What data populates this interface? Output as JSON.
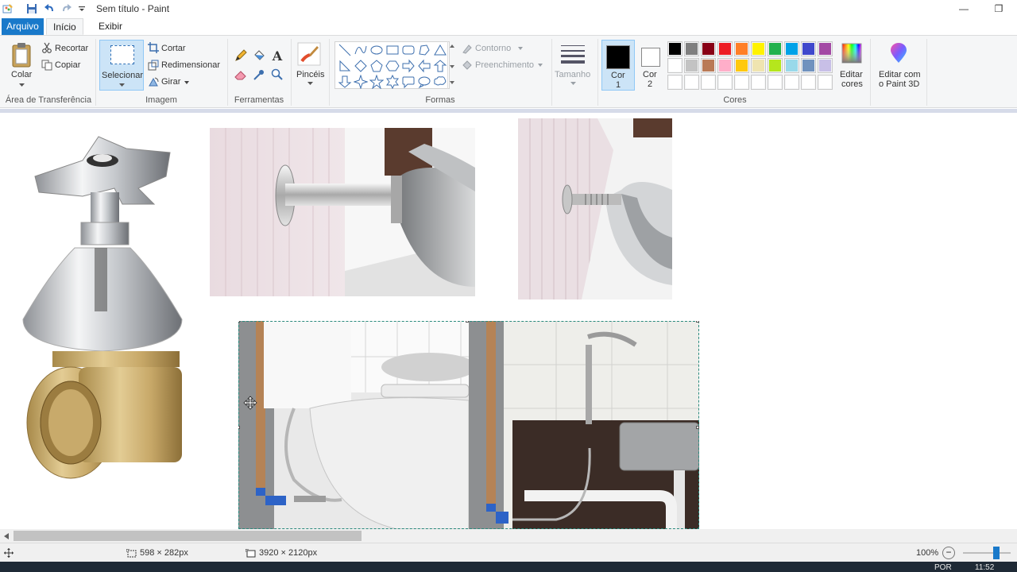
{
  "window": {
    "title": "Sem título - Paint",
    "minimize_glyph": "—",
    "restore_glyph": "❐"
  },
  "menu": {
    "file_tab": "Arquivo",
    "tabs": [
      "Início",
      "Exibir"
    ]
  },
  "clipboard": {
    "paste_label": "Colar",
    "cut_label": "Recortar",
    "copy_label": "Copiar",
    "group_label": "Área de Transferência"
  },
  "image": {
    "select_label": "Selecionar",
    "crop_label": "Cortar",
    "resize_label": "Redimensionar",
    "rotate_label": "Girar",
    "group_label": "Imagem"
  },
  "tools": {
    "group_label": "Ferramentas",
    "brushes_label": "Pincéis"
  },
  "shapes": {
    "outline_label": "Contorno",
    "fill_label": "Preenchimento",
    "group_label": "Formas",
    "icons": [
      "line-icon",
      "curve-icon",
      "oval-icon",
      "rectangle-icon",
      "rounded-rectangle-icon",
      "polygon-icon",
      "triangle-icon",
      "right-triangle-icon",
      "diamond-icon",
      "pentagon-icon",
      "hexagon-icon",
      "right-arrow-icon",
      "left-arrow-icon",
      "up-arrow-icon",
      "down-arrow-icon",
      "four-point-star-icon",
      "five-point-star-icon",
      "six-point-star-icon",
      "rounded-callout-icon",
      "oval-callout-icon",
      "cloud-callout-icon"
    ]
  },
  "size": {
    "label": "Tamanho"
  },
  "colors": {
    "color1_label": "Cor",
    "color1_num": "1",
    "color2_label": "Cor",
    "color2_num": "2",
    "color1": "#000000",
    "color2": "#ffffff",
    "edit_label_1": "Editar",
    "edit_label_2": "cores",
    "group_label": "Cores",
    "palette_row1": [
      "#000000",
      "#7f7f7f",
      "#880015",
      "#ed1c24",
      "#ff7f27",
      "#fff200",
      "#22b14c",
      "#00a2e8",
      "#3f48cc",
      "#a349a4"
    ],
    "palette_row2": [
      "#ffffff",
      "#c3c3c3",
      "#b97a57",
      "#ffaec9",
      "#ffc90e",
      "#efe4b0",
      "#b5e61d",
      "#99d9ea",
      "#7092be",
      "#c8bfe7"
    ],
    "palette_row3": [
      "#ffffff",
      "#ffffff",
      "#ffffff",
      "#ffffff",
      "#ffffff",
      "#ffffff",
      "#ffffff",
      "#ffffff",
      "#ffffff",
      "#ffffff"
    ]
  },
  "paint3d": {
    "label_1": "Editar com",
    "label_2": "o Paint 3D"
  },
  "status": {
    "selection_size": "598 × 282px",
    "canvas_size": "3920 × 2120px",
    "zoom": "100%",
    "zoom_out": "−"
  },
  "taskbar": {
    "lang": "POR",
    "time": "11:52"
  }
}
